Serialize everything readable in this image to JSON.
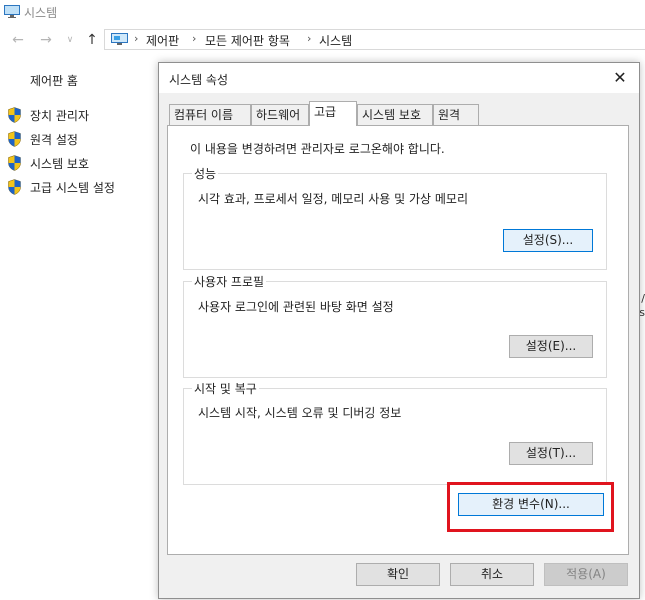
{
  "window": {
    "title": "시스템",
    "icon": "monitor-icon"
  },
  "address_bar": {
    "icon": "control-panel-icon",
    "path": [
      "제어판",
      "모든 제어판 항목",
      "시스템"
    ]
  },
  "sidebar": {
    "home": "제어판 홈",
    "items": [
      {
        "label": "장치 관리자",
        "icon": "uac-shield-icon"
      },
      {
        "label": "원격 설정",
        "icon": "uac-shield-icon"
      },
      {
        "label": "시스템 보호",
        "icon": "uac-shield-icon"
      },
      {
        "label": "고급 시스템 설정",
        "icon": "uac-shield-icon"
      }
    ]
  },
  "background_fragments": {
    "frag1": "/",
    "frag2": "s"
  },
  "dialog": {
    "title": "시스템 속성",
    "tabs": [
      "컴퓨터 이름",
      "하드웨어",
      "고급",
      "시스템 보호",
      "원격"
    ],
    "active_tab": "고급",
    "admin_note": "이 내용을 변경하려면 관리자로 로그온해야 합니다.",
    "groups": {
      "performance": {
        "title": "성능",
        "desc": "시각 효과, 프로세서 일정, 메모리 사용 및 가상 메모리",
        "button": "설정(S)..."
      },
      "user_profile": {
        "title": "사용자 프로필",
        "desc": "사용자 로그인에 관련된 바탕 화면 설정",
        "button": "설정(E)..."
      },
      "startup": {
        "title": "시작 및 복구",
        "desc": "시스템 시작, 시스템 오류 및 디버깅 정보",
        "button": "설정(T)..."
      }
    },
    "env_button": "환경 변수(N)...",
    "ok": "확인",
    "cancel": "취소",
    "apply": "적용(A)"
  },
  "colors": {
    "highlight": "#e0141e",
    "focus_border": "#0078d7",
    "shield_blue": "#1e63c6",
    "shield_yellow": "#f2c41a"
  }
}
